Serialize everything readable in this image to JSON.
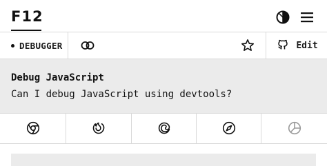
{
  "header": {
    "logo": "F12",
    "theme_icon": "contrast-icon",
    "menu_icon": "hamburger-menu-icon"
  },
  "toolbar": {
    "category_badge": "DEBUGGER",
    "link_icon": "link-icon",
    "star_icon": "star-icon",
    "github_icon": "github-icon",
    "edit_label": "Edit"
  },
  "card": {
    "title": "Debug JavaScript",
    "question": "Can I debug JavaScript using devtools?"
  },
  "browsers": [
    {
      "name": "chrome",
      "icon": "chrome-icon"
    },
    {
      "name": "firefox",
      "icon": "firefox-icon"
    },
    {
      "name": "edge",
      "icon": "edge-icon"
    },
    {
      "name": "safari",
      "icon": "safari-icon"
    },
    {
      "name": "internet-explorer",
      "icon": "ie-icon"
    }
  ],
  "colors": {
    "text": "#111111",
    "border": "#d9d9d9",
    "panel_bg": "#ebebeb",
    "muted_icon": "#9a9a9a"
  }
}
